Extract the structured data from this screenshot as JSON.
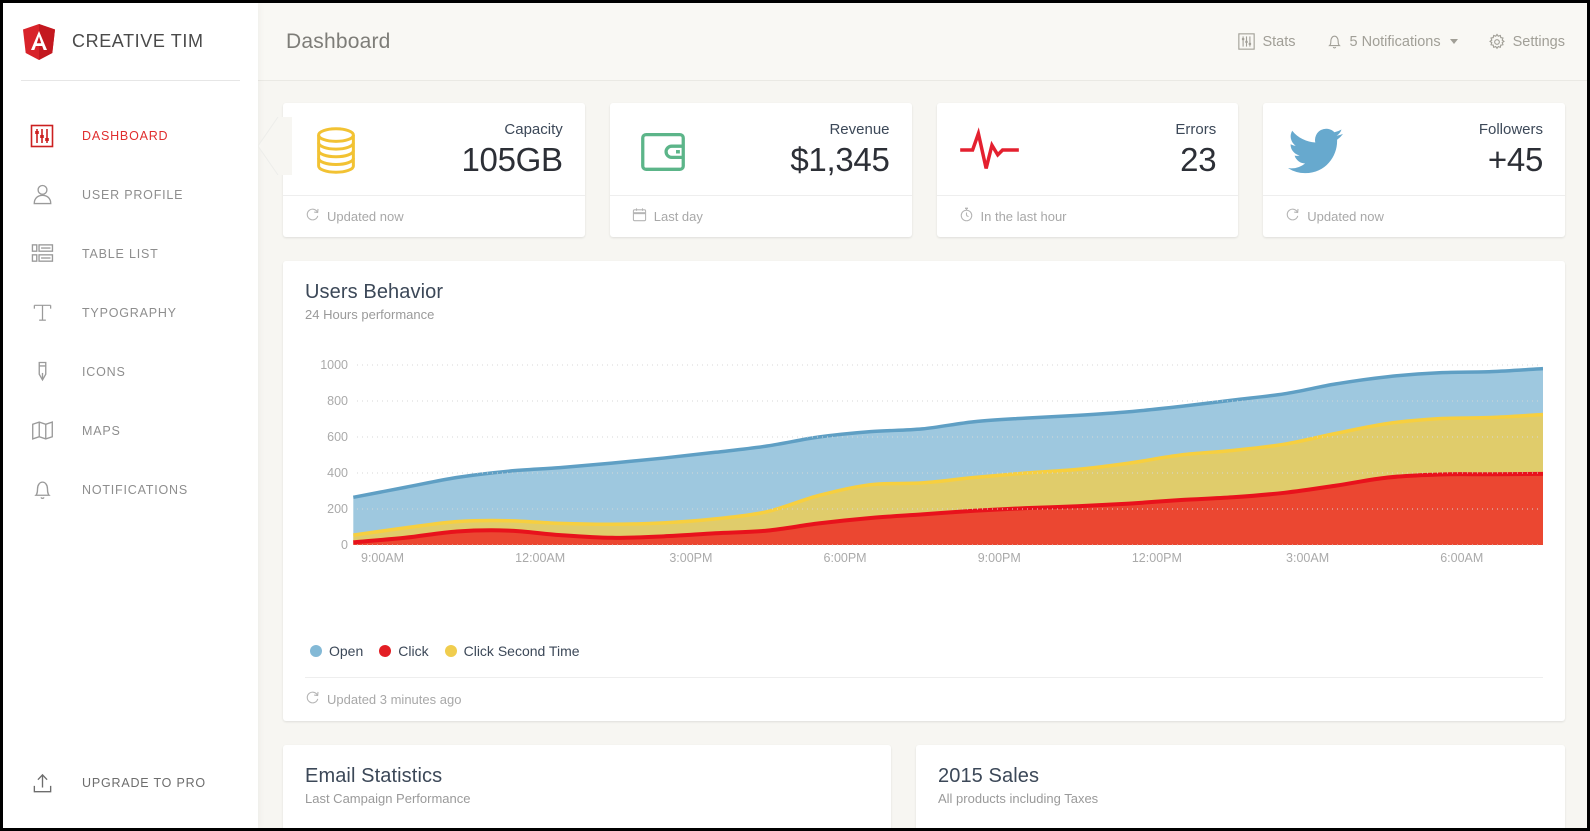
{
  "brand": {
    "name": "CREATIVE TIM",
    "logo_icon": "angular-shield-icon"
  },
  "sidebar": {
    "items": [
      {
        "label": "DASHBOARD",
        "icon": "sliders-dashboard-icon",
        "active": true
      },
      {
        "label": "USER PROFILE",
        "icon": "user-icon",
        "active": false
      },
      {
        "label": "TABLE LIST",
        "icon": "table-list-icon",
        "active": false
      },
      {
        "label": "TYPOGRAPHY",
        "icon": "typography-t-icon",
        "active": false
      },
      {
        "label": "ICONS",
        "icon": "pen-icon",
        "active": false
      },
      {
        "label": "MAPS",
        "icon": "map-icon",
        "active": false
      },
      {
        "label": "NOTIFICATIONS",
        "icon": "bell-icon",
        "active": false
      }
    ],
    "upgrade": {
      "label": "UPGRADE TO PRO",
      "icon": "upload-box-icon"
    }
  },
  "header": {
    "title": "Dashboard",
    "nav": [
      {
        "label": "Stats",
        "icon": "stats-icon"
      },
      {
        "label": "5 Notifications",
        "icon": "bell-icon",
        "has_caret": true
      },
      {
        "label": "Settings",
        "icon": "gear-icon"
      }
    ]
  },
  "stats": [
    {
      "icon": "database-icon",
      "icon_color": "#f2c233",
      "label": "Capacity",
      "value": "105GB",
      "footer_icon": "refresh-icon",
      "footer": "Updated now"
    },
    {
      "icon": "wallet-icon",
      "icon_color": "#5cb589",
      "label": "Revenue",
      "value": "$1,345",
      "footer_icon": "calendar-icon",
      "footer": "Last day"
    },
    {
      "icon": "pulse-icon",
      "icon_color": "#e4202f",
      "label": "Errors",
      "value": "23",
      "footer_icon": "clock-icon",
      "footer": "In the last hour"
    },
    {
      "icon": "twitter-icon",
      "icon_color": "#67a9ce",
      "label": "Followers",
      "value": "+45",
      "footer_icon": "refresh-icon",
      "footer": "Updated now"
    }
  ],
  "users_behavior": {
    "title": "Users Behavior",
    "subtitle": "24 Hours performance",
    "footer_icon": "refresh-icon",
    "footer": "Updated 3 minutes ago"
  },
  "chart_data": {
    "type": "area",
    "stacked": true,
    "title": "Users Behavior",
    "subtitle": "24 Hours performance",
    "xlabel": "",
    "ylabel": "",
    "ylim": [
      0,
      1000
    ],
    "yticks": [
      0,
      200,
      400,
      600,
      800,
      1000
    ],
    "grid": true,
    "legend_position": "bottom-left",
    "x_tick_labels": [
      "9:00AM",
      "12:00AM",
      "3:00PM",
      "6:00PM",
      "9:00PM",
      "12:00PM",
      "3:00AM",
      "6:00AM"
    ],
    "x": [
      0,
      1,
      2,
      3,
      4,
      5,
      6,
      7,
      8,
      9,
      10,
      11,
      12,
      13,
      14,
      15,
      16,
      17,
      18,
      19,
      20,
      21,
      22,
      23
    ],
    "series": [
      {
        "name": "Click",
        "color": "#ec3c2c",
        "values": [
          15,
          40,
          75,
          80,
          55,
          40,
          48,
          65,
          80,
          120,
          150,
          170,
          190,
          205,
          215,
          230,
          250,
          265,
          290,
          330,
          375,
          392,
          393,
          395
        ]
      },
      {
        "name": "Click Second Time",
        "color": "#f0cd4e",
        "values": [
          40,
          55,
          55,
          55,
          65,
          75,
          75,
          80,
          105,
          155,
          185,
          175,
          185,
          195,
          205,
          225,
          250,
          260,
          270,
          290,
          300,
          310,
          315,
          330
        ]
      },
      {
        "name": "Open",
        "color": "#83b9d6",
        "values": [
          210,
          225,
          245,
          275,
          310,
          340,
          360,
          370,
          365,
          325,
          295,
          300,
          310,
          305,
          300,
          285,
          270,
          280,
          280,
          275,
          260,
          255,
          255,
          255
        ]
      }
    ],
    "legend": [
      {
        "label": "Open",
        "color": "#83b9d6"
      },
      {
        "label": "Click",
        "color": "#e31e24"
      },
      {
        "label": "Click Second Time",
        "color": "#f0cd4e"
      }
    ]
  },
  "email_statistics": {
    "title": "Email Statistics",
    "subtitle": "Last Campaign Performance"
  },
  "sales_2015": {
    "title": "2015 Sales",
    "subtitle": "All products including Taxes"
  },
  "colors": {
    "accent_red": "#e02e2e",
    "page_bg": "#f7f6f2",
    "card_bg": "#ffffff",
    "muted_text": "#9a9a9a"
  }
}
